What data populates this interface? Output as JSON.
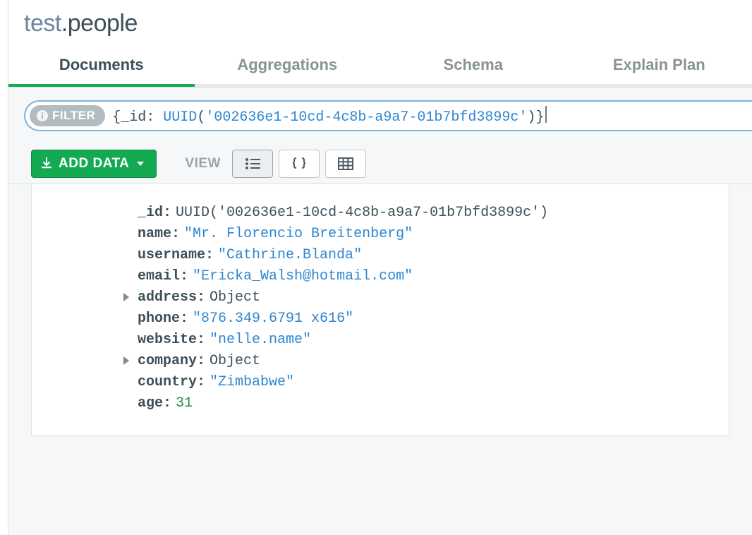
{
  "title": {
    "db": "test",
    "sep": ".",
    "coll": "people"
  },
  "tabs": {
    "documents": "Documents",
    "aggregations": "Aggregations",
    "schema": "Schema",
    "explain": "Explain Plan"
  },
  "filter": {
    "pill": "FILTER",
    "query_prefix": "{",
    "query_key": "_id",
    "query_colon": ": ",
    "query_func": "UUID",
    "query_open": "(",
    "query_str": "'002636e1-10cd-4c8b-a9a7-01b7bfd3899c'",
    "query_close": ")}"
  },
  "toolbar": {
    "add_data": "ADD DATA",
    "view_label": "VIEW"
  },
  "doc": {
    "fields": {
      "_id": {
        "key": "_id",
        "type": "plain",
        "value": "UUID('002636e1-10cd-4c8b-a9a7-01b7bfd3899c')"
      },
      "name": {
        "key": "name",
        "type": "string",
        "value": "\"Mr. Florencio Breitenberg\""
      },
      "username": {
        "key": "username",
        "type": "string",
        "value": "\"Cathrine.Blanda\""
      },
      "email": {
        "key": "email",
        "type": "string",
        "value": "\"Ericka_Walsh@hotmail.com\""
      },
      "address": {
        "key": "address",
        "type": "plain",
        "value": "Object",
        "expandable": true
      },
      "phone": {
        "key": "phone",
        "type": "string",
        "value": "\"876.349.6791 x616\""
      },
      "website": {
        "key": "website",
        "type": "string",
        "value": "\"nelle.name\""
      },
      "company": {
        "key": "company",
        "type": "plain",
        "value": "Object",
        "expandable": true
      },
      "country": {
        "key": "country",
        "type": "string",
        "value": "\"Zimbabwe\""
      },
      "age": {
        "key": "age",
        "type": "number",
        "value": "31"
      }
    }
  }
}
